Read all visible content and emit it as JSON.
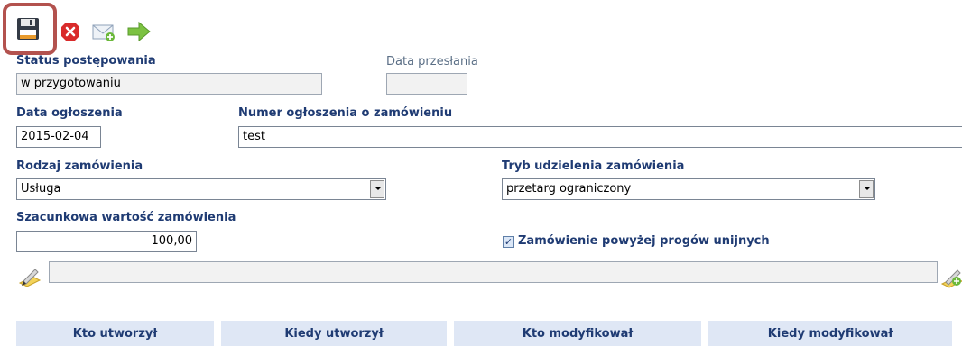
{
  "toolbar": {
    "save_icon": "floppy-disk-icon",
    "delete_icon": "red-x-icon",
    "send_icon": "envelope-add-icon",
    "forward_icon": "green-arrow-icon"
  },
  "fields": {
    "status_label": "Status postępowania",
    "status_value": "w przygotowaniu",
    "sent_date_label": "Data przesłania",
    "sent_date_value": "",
    "announcement_date_label": "Data ogłoszenia",
    "announcement_date_value": "2015-02-04",
    "announcement_number_label": "Numer ogłoszenia o zamówieniu",
    "announcement_number_value": "test",
    "order_type_label": "Rodzaj zamówienia",
    "order_type_value": "Usługa",
    "award_mode_label": "Tryb udzielenia zamówienia",
    "award_mode_value": "przetarg ograniczony",
    "estimated_value_label": "Szacunkowa wartość zamówienia",
    "estimated_value_value": "100,00",
    "eu_threshold_label": "Zamówienie powyżej progów unijnych",
    "eu_threshold_checked": true,
    "attachment_value": ""
  },
  "table_headers": [
    "Kto utworzył",
    "Kiedy utworzył",
    "Kto modyfikował",
    "Kiedy modyfikował"
  ],
  "colors": {
    "label": "#1f3b73",
    "header_bg": "#dfe7f5",
    "highlight": "#b3524e"
  }
}
